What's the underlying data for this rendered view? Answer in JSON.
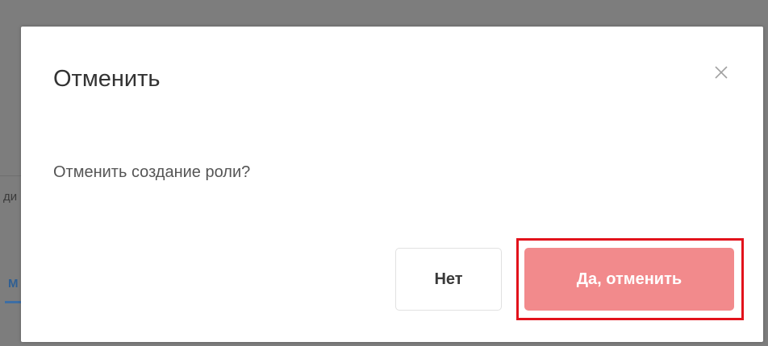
{
  "background": {
    "partial_text_1": "ди",
    "partial_text_2": "М"
  },
  "dialog": {
    "title": "Отменить",
    "close_icon": "close-icon",
    "message": "Отменить создание роли?",
    "buttons": {
      "no_label": "Нет",
      "yes_label": "Да, отменить"
    }
  },
  "colors": {
    "overlay": "#7d7d7d",
    "confirm_button": "#f28a8c",
    "highlight_frame": "#e2121b",
    "title_text": "#333333"
  }
}
